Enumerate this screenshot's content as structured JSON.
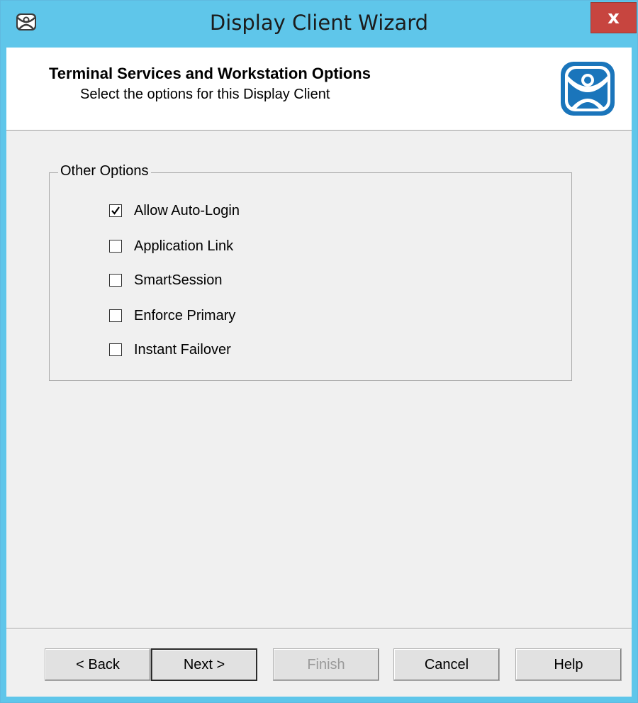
{
  "window": {
    "title": "Display Client Wizard",
    "close_label": "x"
  },
  "header": {
    "title": "Terminal Services and Workstation Options",
    "subtitle": "Select the options for this Display Client",
    "logo_icon": "thinmanager-logo-icon"
  },
  "group": {
    "label": "Other Options",
    "options": [
      {
        "label": "Allow Auto-Login",
        "checked": true
      },
      {
        "label": "Application Link",
        "checked": false
      },
      {
        "label": "SmartSession",
        "checked": false
      },
      {
        "label": "Enforce Primary",
        "checked": false
      },
      {
        "label": "Instant Failover",
        "checked": false
      }
    ]
  },
  "buttons": {
    "back": "< Back",
    "next": "Next >",
    "finish": "Finish",
    "cancel": "Cancel",
    "help": "Help"
  },
  "colors": {
    "titlebar": "#5fc6ea",
    "close_button": "#c7453f",
    "logo_blue": "#1a75bb"
  }
}
